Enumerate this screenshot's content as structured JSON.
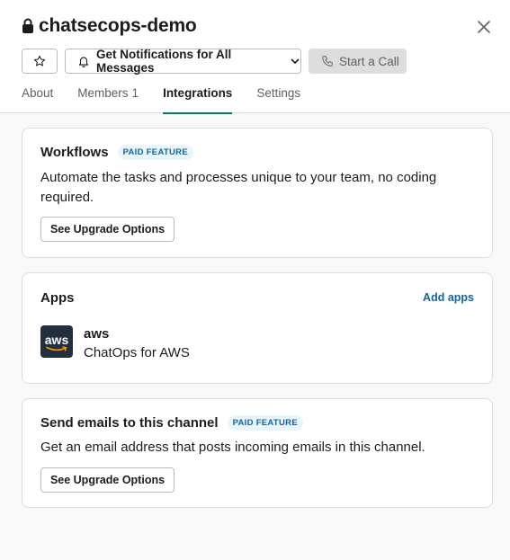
{
  "channel": {
    "name": "chatsecops-demo"
  },
  "header": {
    "notifications_label": "Get Notifications for All Messages",
    "call_label": "Start a Call"
  },
  "tabs": [
    {
      "label": "About"
    },
    {
      "label": "Members",
      "count": "1"
    },
    {
      "label": "Integrations",
      "active": true
    },
    {
      "label": "Settings"
    }
  ],
  "workflows": {
    "title": "Workflows",
    "badge": "PAID FEATURE",
    "description": "Automate the tasks and processes unique to your team, no coding required.",
    "button": "See Upgrade Options"
  },
  "apps": {
    "title": "Apps",
    "add_label": "Add apps",
    "items": [
      {
        "logo_text": "aws",
        "name": "aws",
        "description": "ChatOps for AWS"
      }
    ]
  },
  "emails": {
    "title": "Send emails to this channel",
    "badge": "PAID FEATURE",
    "description": "Get an email address that posts incoming emails in this channel.",
    "button": "See Upgrade Options"
  },
  "colors": {
    "accent_tab": "#007a5a",
    "link": "#1264a3",
    "badge_bg": "#e8f5fa",
    "aws_bg": "#232f3e",
    "aws_smile": "#ff9900"
  },
  "icons": {
    "lock": "lock-icon",
    "close": "close-icon",
    "star": "star-icon",
    "bell": "bell-icon",
    "chevron": "chevron-down-icon",
    "phone": "phone-icon"
  }
}
